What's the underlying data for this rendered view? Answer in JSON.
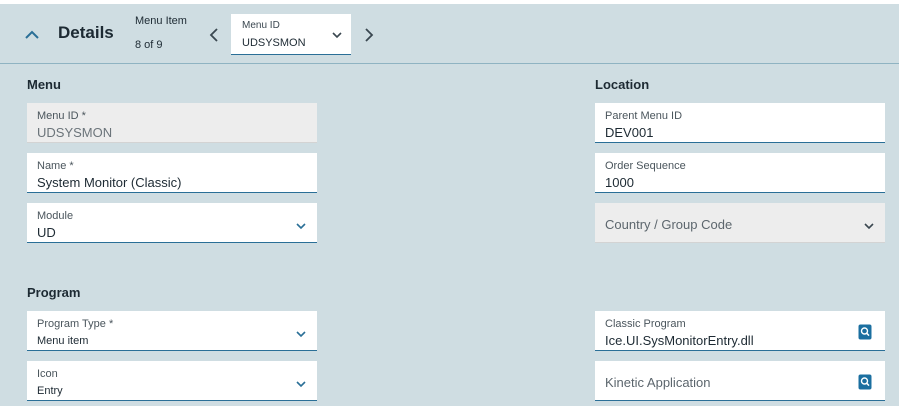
{
  "header": {
    "title": "Details",
    "nav_item_label": "Menu Item",
    "nav_item_count": "8 of 9",
    "menu_id_select": {
      "label": "Menu ID",
      "value": "UDSYSMON"
    }
  },
  "menu_section": {
    "title": "Menu",
    "menu_id": {
      "label": "Menu ID *",
      "value": "UDSYSMON"
    },
    "name": {
      "label": "Name *",
      "value": "System Monitor (Classic)"
    },
    "module": {
      "label": "Module",
      "value": "UD"
    }
  },
  "location_section": {
    "title": "Location",
    "parent_menu_id": {
      "label": "Parent Menu ID",
      "value": "DEV001"
    },
    "order_sequence": {
      "label": "Order Sequence",
      "value": "1000"
    },
    "country_group_code": {
      "placeholder": "Country / Group Code"
    }
  },
  "program_section": {
    "title": "Program",
    "program_type": {
      "label": "Program Type *",
      "value": "Menu item"
    },
    "icon": {
      "label": "Icon",
      "value": "Entry"
    },
    "classic_program": {
      "label": "Classic Program",
      "value": "Ice.UI.SysMonitorEntry.dll"
    },
    "kinetic_application": {
      "placeholder": "Kinetic Application"
    }
  },
  "colors": {
    "background": "#cfdde2",
    "accent": "#2a6f97",
    "search_icon": "#1b6fa0"
  },
  "icons": [
    "chevron-up-icon",
    "chevron-left-icon",
    "chevron-right-icon",
    "chevron-down-icon",
    "search-icon"
  ]
}
